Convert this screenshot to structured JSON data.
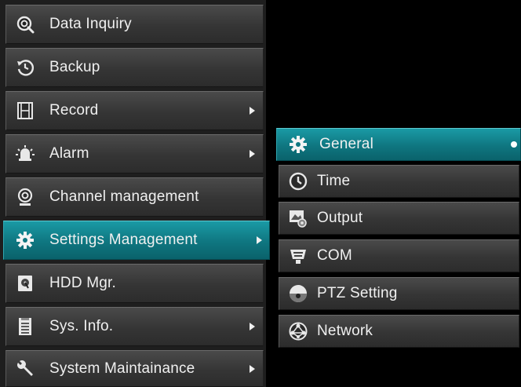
{
  "main_menu": {
    "items": [
      {
        "label": "Data Inquiry",
        "icon": "magnifier-icon",
        "has_submenu": false
      },
      {
        "label": "Backup",
        "icon": "backup-clock-icon",
        "has_submenu": false
      },
      {
        "label": "Record",
        "icon": "film-strip-icon",
        "has_submenu": true
      },
      {
        "label": "Alarm",
        "icon": "alarm-light-icon",
        "has_submenu": true
      },
      {
        "label": "Channel management",
        "icon": "webcam-icon",
        "has_submenu": false
      },
      {
        "label": "Settings Management",
        "icon": "gear-icon",
        "has_submenu": true,
        "selected": true
      },
      {
        "label": "HDD Mgr.",
        "icon": "hard-disk-icon",
        "has_submenu": false
      },
      {
        "label": "Sys. Info.",
        "icon": "document-icon",
        "has_submenu": true
      },
      {
        "label": "System Maintainance",
        "icon": "wrench-icon",
        "has_submenu": true
      }
    ]
  },
  "submenu": {
    "items": [
      {
        "label": "General",
        "icon": "gear-icon",
        "selected": true
      },
      {
        "label": "Time",
        "icon": "clock-icon"
      },
      {
        "label": "Output",
        "icon": "output-settings-icon"
      },
      {
        "label": "COM",
        "icon": "serial-port-icon"
      },
      {
        "label": "PTZ Setting",
        "icon": "ptz-camera-icon"
      },
      {
        "label": "Network",
        "icon": "network-globe-icon"
      }
    ]
  },
  "colors": {
    "selected": "#0f7680",
    "item": "#3a3a3a",
    "background": "#000000",
    "text": "#f0f0f0"
  }
}
